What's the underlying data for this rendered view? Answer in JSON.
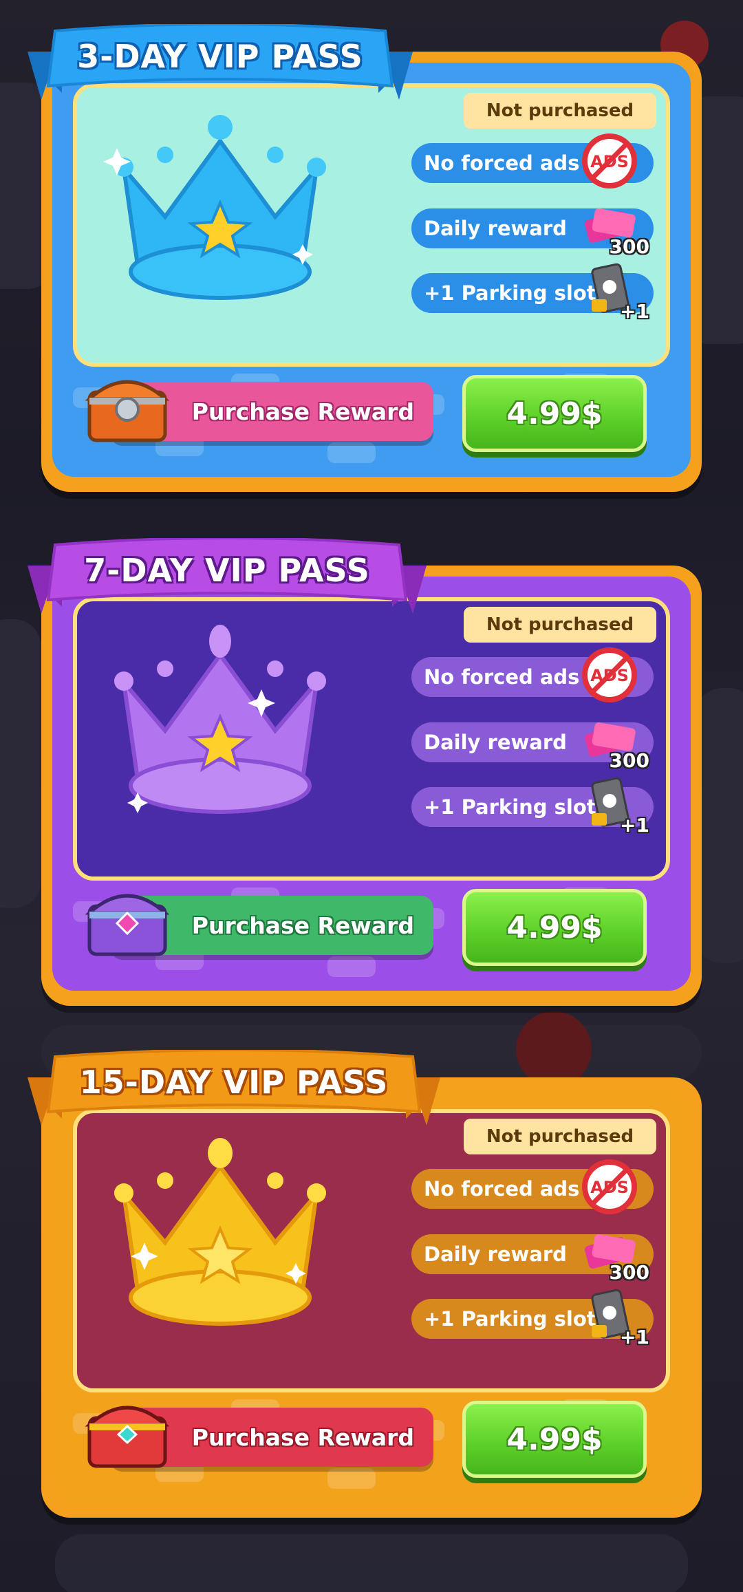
{
  "passes": [
    {
      "title": "3-DAY VIP PASS",
      "status": "Not purchased",
      "perks": [
        {
          "label": "No forced ads",
          "icon": "no-ads-icon"
        },
        {
          "label": "Daily reward",
          "icon": "tickets-icon",
          "qty": "300"
        },
        {
          "label": "+1 Parking slot",
          "icon": "parking-ticket-icon",
          "qty": "+1"
        }
      ],
      "reward_label": "Purchase Reward",
      "price": "4.99$",
      "colors": {
        "body": "#3f9cf0",
        "inner": "#a8f0e2",
        "ribbon": "#2aa4f4",
        "perk": "#2b8fe8",
        "reward": "#e9579a",
        "crown": "#2fb6f5"
      }
    },
    {
      "title": "7-DAY VIP PASS",
      "status": "Not purchased",
      "perks": [
        {
          "label": "No forced ads",
          "icon": "no-ads-icon"
        },
        {
          "label": "Daily reward",
          "icon": "tickets-icon",
          "qty": "300"
        },
        {
          "label": "+1 Parking slot",
          "icon": "parking-ticket-icon",
          "qty": "+1"
        }
      ],
      "reward_label": "Purchase Reward",
      "price": "4.99$",
      "colors": {
        "body": "#9b4fe8",
        "inner": "#4a2ca8",
        "ribbon": "#b84de6",
        "perk": "#8a5bd6",
        "reward": "#3fb86a",
        "crown": "#b274ef"
      }
    },
    {
      "title": "15-DAY VIP PASS",
      "status": "Not purchased",
      "perks": [
        {
          "label": "No forced ads",
          "icon": "no-ads-icon"
        },
        {
          "label": "Daily reward",
          "icon": "tickets-icon",
          "qty": "300"
        },
        {
          "label": "+1 Parking slot",
          "icon": "parking-ticket-icon",
          "qty": "+1"
        }
      ],
      "reward_label": "Purchase Reward",
      "price": "4.99$",
      "colors": {
        "body": "#f3a21c",
        "inner": "#9a2c4c",
        "ribbon": "#f29a18",
        "perk": "#d8891e",
        "reward": "#e0384e",
        "crown": "#f7c21c"
      }
    }
  ]
}
